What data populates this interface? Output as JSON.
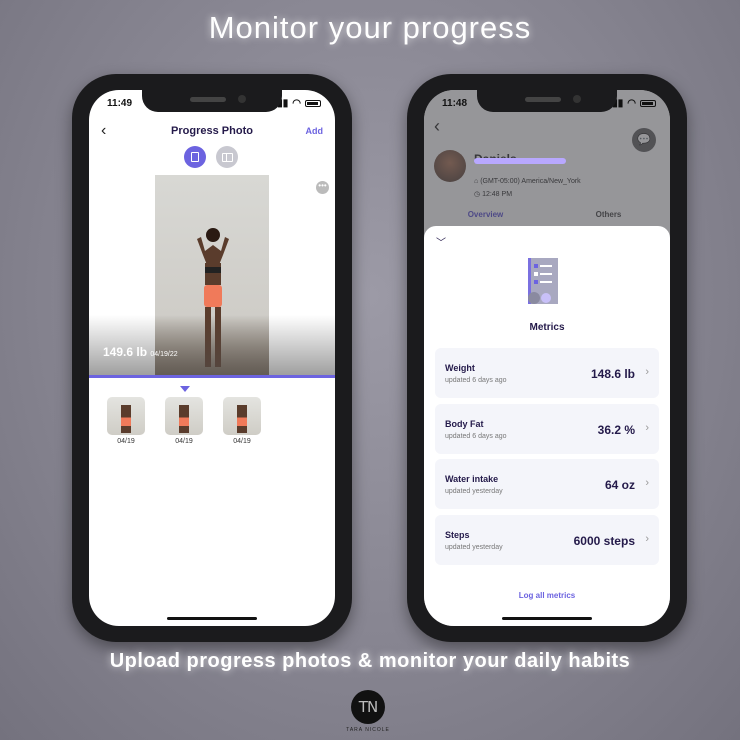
{
  "headline": "Monitor your progress",
  "footer": "Upload progress photos & monitor your daily habits",
  "logo": {
    "initials": "TN",
    "subtitle": "TARA NICOLE"
  },
  "left_phone": {
    "status_time": "11:49",
    "nav": {
      "back": "‹",
      "title": "Progress Photo",
      "add": "Add"
    },
    "photo": {
      "weight": "149.6 lb",
      "date": "04/19/22",
      "more": "•••"
    },
    "thumbnails": [
      {
        "date": "04/19"
      },
      {
        "date": "04/19"
      },
      {
        "date": "04/19"
      }
    ]
  },
  "right_phone": {
    "status_time": "11:48",
    "profile": {
      "name": "Daniels",
      "timezone": "(GMT-05:00) America/New_York",
      "local_time": "12:48 PM"
    },
    "tabs": [
      "Overview",
      "Others"
    ],
    "sheet": {
      "title": "Metrics",
      "metrics": [
        {
          "label": "Weight",
          "updated": "updated 6 days ago",
          "value": "148.6 lb"
        },
        {
          "label": "Body Fat",
          "updated": "updated 6 days ago",
          "value": "36.2 %"
        },
        {
          "label": "Water intake",
          "updated": "updated yesterday",
          "value": "64 oz"
        },
        {
          "label": "Steps",
          "updated": "updated yesterday",
          "value": "6000 steps"
        }
      ],
      "log_all": "Log all metrics"
    }
  },
  "colors": {
    "accent": "#6c63e0",
    "title": "#241a4a"
  }
}
